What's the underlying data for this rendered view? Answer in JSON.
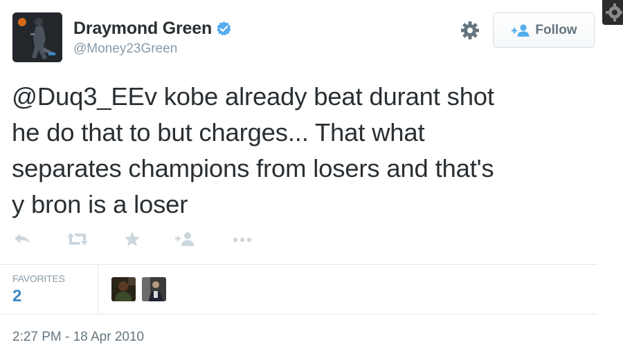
{
  "user": {
    "name": "Draymond Green",
    "handle": "@Money23Green",
    "verified": true
  },
  "header": {
    "follow_label": "Follow"
  },
  "tweet": {
    "lines": [
      "@Duq3_EEv kobe already beat durant shot",
      "he do that to but charges... That what",
      "separates champions from losers and that's",
      "y bron is a loser"
    ]
  },
  "actions": [
    "reply-icon",
    "retweet-icon",
    "favorite-icon",
    "follow-icon",
    "more-icon"
  ],
  "stats": {
    "favorites_label": "FAVORITES",
    "favorites_count": "2"
  },
  "meta": {
    "timestamp": "2:27 PM - 18 Apr 2010"
  },
  "colors": {
    "accent": "#3b88c3",
    "verified": "#55acee",
    "icon_gray": "#ccd6dd",
    "text": "#292f33",
    "muted": "#8899a6"
  }
}
